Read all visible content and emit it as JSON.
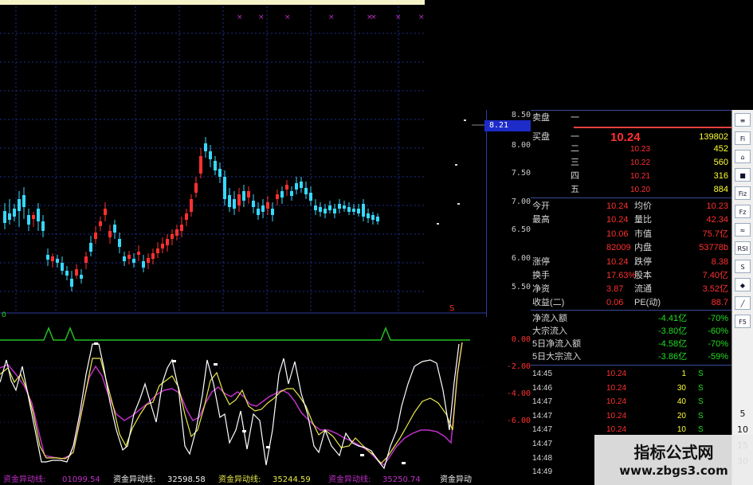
{
  "price_axis": {
    "ticks": [
      "8.50",
      "8.00",
      "7.50",
      "7.00",
      "6.50",
      "6.00",
      "5.50"
    ],
    "current_price_tag": "8.21"
  },
  "indicator_axis": {
    "ticks": [
      "0.00",
      "-2.00",
      "-4.00",
      "-6.00"
    ]
  },
  "indicator_marker": "0",
  "sell_row": {
    "label": "卖盘",
    "level": "一"
  },
  "buy_rows": [
    {
      "label": "买盘",
      "level": "一",
      "price": "10.24",
      "vol": "139802"
    },
    {
      "label": "",
      "level": "二",
      "price": "10.23",
      "vol": "452"
    },
    {
      "label": "",
      "level": "三",
      "price": "10.22",
      "vol": "560"
    },
    {
      "label": "",
      "level": "四",
      "price": "10.21",
      "vol": "316"
    },
    {
      "label": "",
      "level": "五",
      "price": "10.20",
      "vol": "884"
    }
  ],
  "stats": [
    {
      "l1": "今开",
      "v1": "10.24",
      "l2": "均价",
      "v2": "10.23"
    },
    {
      "l1": "最高",
      "v1": "10.24",
      "l2": "量比",
      "v2": "42.34"
    },
    {
      "l1": "",
      "v1": "10.06",
      "l2": "市值",
      "v2": "75.7亿"
    },
    {
      "l1": "",
      "v1": "82009",
      "l2": "内盘",
      "v2": "53778b"
    },
    {
      "l1": "涨停",
      "v1": "10.24",
      "l2": "跌停",
      "v2": "8.38"
    },
    {
      "l1": "换手",
      "v1": "17.63%",
      "l2": "股本",
      "v2": "7.40亿"
    },
    {
      "l1": "净资",
      "v1": "3.87",
      "l2": "流通",
      "v2": "3.52亿"
    },
    {
      "l1": "收益(二)",
      "v1": "0.06",
      "l2": "PE(动)",
      "v2": "88.7"
    }
  ],
  "flows": [
    {
      "label": "净流入额",
      "value": "-4.41亿",
      "pct": "-70%"
    },
    {
      "label": "大宗流入",
      "value": "-3.80亿",
      "pct": "-60%"
    },
    {
      "label": "5日净流入额",
      "value": "-4.58亿",
      "pct": "-70%"
    },
    {
      "label": "5日大宗流入",
      "value": "-3.86亿",
      "pct": "-59%"
    }
  ],
  "ticks_list": [
    {
      "time": "14:45",
      "price": "10.24",
      "vol": "1",
      "flag": "S"
    },
    {
      "time": "14:46",
      "price": "10.24",
      "vol": "30",
      "flag": "S"
    },
    {
      "time": "14:47",
      "price": "10.24",
      "vol": "40",
      "flag": "S"
    },
    {
      "time": "14:47",
      "price": "10.24",
      "vol": "20",
      "flag": "S"
    },
    {
      "time": "14:47",
      "price": "10.24",
      "vol": "10",
      "flag": "S"
    },
    {
      "time": "14:47",
      "price": "",
      "vol": "",
      "flag": ""
    },
    {
      "time": "14:48",
      "price": "",
      "vol": "",
      "flag": ""
    },
    {
      "time": "14:49",
      "price": "",
      "vol": "",
      "flag": ""
    }
  ],
  "toolbar": {
    "buttons": [
      "≡",
      "Fi",
      "⌂",
      "■",
      "Fiz",
      "Fz",
      "≈",
      "RSI",
      "S",
      "◆",
      "╱",
      "F5"
    ],
    "numbers": [
      "5",
      "10",
      "15",
      "30"
    ]
  },
  "bottom_strip": {
    "label_a": "资金异动线:",
    "value_a": "01099.54",
    "label_b": "资金异动线:",
    "value_b": "32598.58",
    "label_c": "资金异动线:",
    "value_c": "35244.59",
    "label_d": "资金异动线:",
    "value_d": "35250.74",
    "label_e": "资金异动"
  },
  "watermark": {
    "title": "指标公式网",
    "url": "www.zbgs3.com"
  },
  "colors": {
    "up": "#ff3030",
    "down": "#38d8ff",
    "grid": "#1c2f8c",
    "line_white": "#ffffff",
    "line_yellow": "#e8e84a",
    "line_magenta": "#c030c8",
    "signal_green": "#22c022"
  }
}
